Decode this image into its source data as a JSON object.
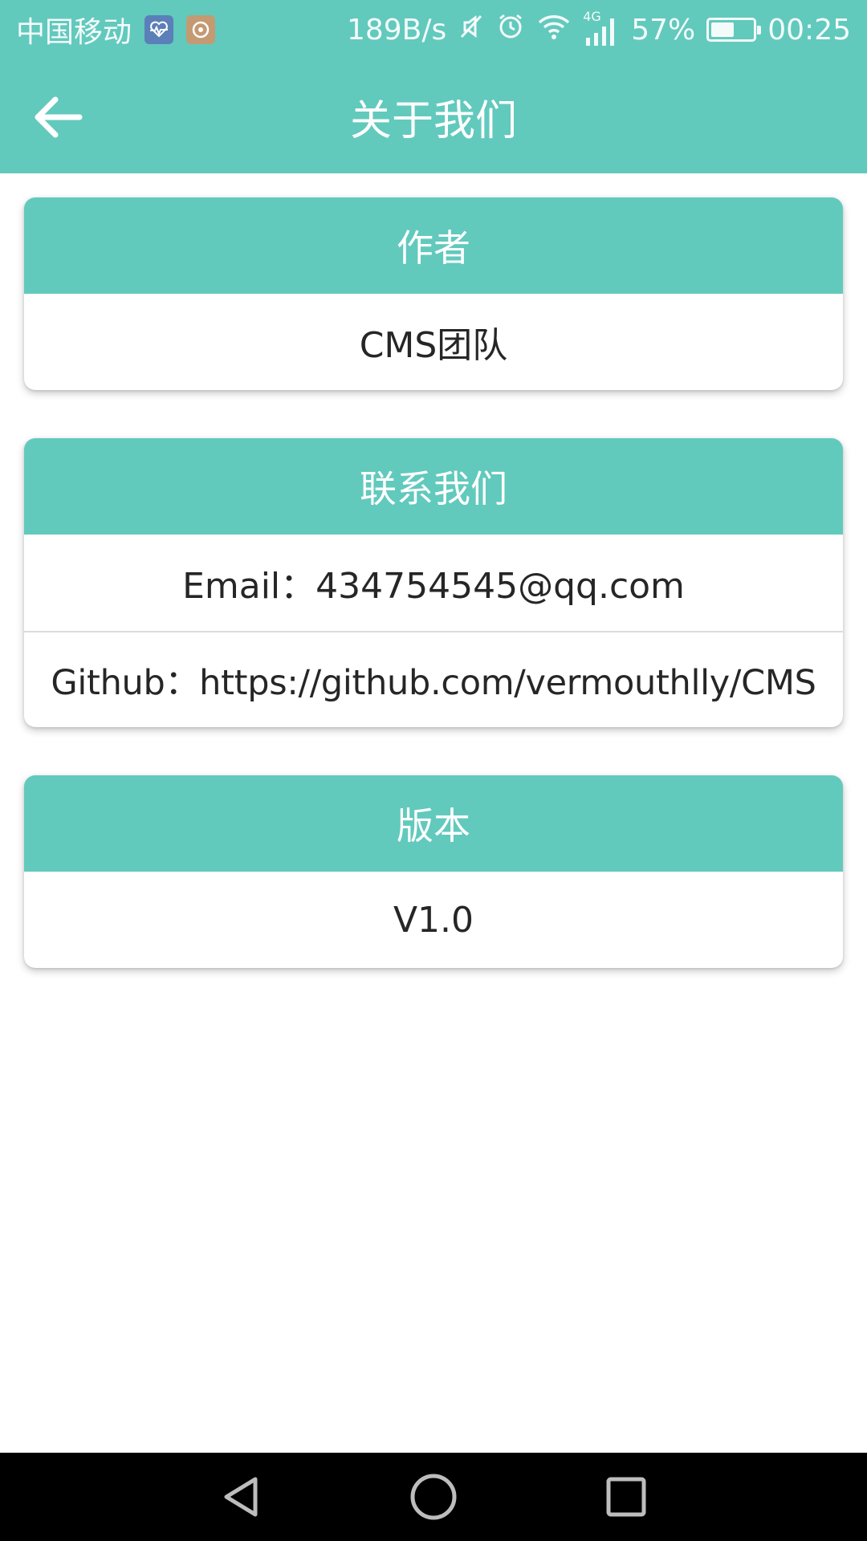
{
  "status_bar": {
    "carrier": "中国移动",
    "net_speed": "189B/s",
    "network_type": "4G",
    "battery": "57%",
    "battery_level": 0.57,
    "time": "00:25",
    "icons": [
      "health-app-icon",
      "app-notification-icon",
      "mute-icon",
      "alarm-icon",
      "wifi-icon",
      "signal-icon",
      "battery-icon"
    ]
  },
  "app_bar": {
    "title": "关于我们",
    "back_icon": "arrow-left-icon"
  },
  "cards": {
    "author": {
      "header": "作者",
      "value": "CMS团队"
    },
    "contact": {
      "header": "联系我们",
      "email": "Email：434754545@qq.com",
      "github": "Github：https://github.com/vermouthlly/CMS"
    },
    "version": {
      "header": "版本",
      "value": "V1.0"
    }
  },
  "nav_bar": {
    "icons": [
      "back-triangle-icon",
      "home-circle-icon",
      "recents-square-icon"
    ]
  },
  "colors": {
    "accent": "#62c9bd",
    "text": "#262626",
    "nav_background": "#000000"
  }
}
